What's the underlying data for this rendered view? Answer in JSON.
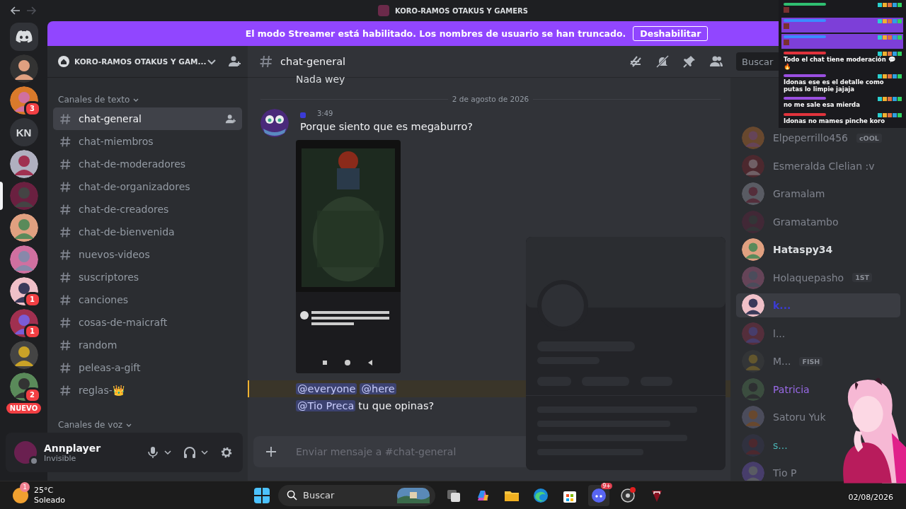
{
  "window": {
    "title": "KORO-RAMOS OTAKUS Y GAMERS"
  },
  "streamer_banner": {
    "text": "El modo Streamer está habilitado. Los nombres de usuario se han truncado.",
    "button": "Deshabilitar"
  },
  "servers": [
    {
      "kind": "logo",
      "selected": false
    },
    {
      "kind": "avatar",
      "selected": false
    },
    {
      "kind": "avatar",
      "selected": false,
      "badge": "3"
    },
    {
      "kind": "initials",
      "selected": false,
      "label": "KN"
    },
    {
      "kind": "avatar",
      "selected": false
    },
    {
      "kind": "avatar",
      "selected": true
    },
    {
      "kind": "avatar",
      "selected": false
    },
    {
      "kind": "avatar",
      "selected": false
    },
    {
      "kind": "avatar",
      "selected": false,
      "badge": "1"
    },
    {
      "kind": "avatar",
      "selected": false,
      "badge": "1"
    },
    {
      "kind": "avatar",
      "selected": false
    },
    {
      "kind": "avatar",
      "selected": false,
      "badge": "2"
    },
    {
      "kind": "new",
      "selected": false,
      "label": "NUEVO"
    }
  ],
  "server_header": {
    "name": "KORO-RAMOS OTAKUS Y GAM..."
  },
  "text_category": "Canales de texto",
  "channels": [
    {
      "name": "chat-general",
      "selected": true
    },
    {
      "name": "chat-miembros",
      "selected": false
    },
    {
      "name": "chat-de-moderadores",
      "selected": false
    },
    {
      "name": "chat-de-organizadores",
      "selected": false
    },
    {
      "name": "chat-de-creadores",
      "selected": false
    },
    {
      "name": "chat-de-bienvenida",
      "selected": false
    },
    {
      "name": "nuevos-videos",
      "selected": false
    },
    {
      "name": "suscriptores",
      "selected": false
    },
    {
      "name": "canciones",
      "selected": false
    },
    {
      "name": "cosas-de-maicraft",
      "selected": false
    },
    {
      "name": "random",
      "selected": false
    },
    {
      "name": "peleas-a-gift",
      "selected": false
    },
    {
      "name": "reglas-👑",
      "selected": false
    }
  ],
  "voice_category": "Canales de voz",
  "user_panel": {
    "name": "Annplayer",
    "status": "Invisible"
  },
  "chat_header": {
    "channel": "chat-general",
    "search_placeholder": "Buscar"
  },
  "messages": [
    {
      "kind": "continuation",
      "text": "Nada wey"
    },
    {
      "kind": "divider",
      "text": "2 de agosto de 2026"
    },
    {
      "kind": "post",
      "time": "3:49",
      "text": "Porque siento que es megaburro?"
    },
    {
      "kind": "attachment"
    },
    {
      "kind": "mentions",
      "highlighted": true,
      "mentions": [
        "@everyone",
        "@here"
      ]
    },
    {
      "kind": "mentions",
      "highlighted": false,
      "mentions": [
        "@Tio Preca"
      ],
      "text": "tu que opinas?"
    }
  ],
  "composer": {
    "placeholder": "Enviar mensaje a #chat-general"
  },
  "members": [
    {
      "name": "Elpeperrillo456",
      "dimmed": true,
      "selected": false,
      "color": "#80848e",
      "tag": "cOOL"
    },
    {
      "name": "Esmeralda Clelian :v",
      "dimmed": true,
      "selected": false,
      "color": "#80848e"
    },
    {
      "name": "Gramalam",
      "dimmed": true,
      "selected": false,
      "color": "#80848e"
    },
    {
      "name": "Gramatambo",
      "dimmed": true,
      "selected": false,
      "color": "#80848e"
    },
    {
      "name": "Hataspy34",
      "dimmed": false,
      "selected": false,
      "color": "#dbdee1"
    },
    {
      "name": "Holaquepasho",
      "dimmed": true,
      "selected": false,
      "color": "#80848e",
      "tag": "1ST"
    },
    {
      "name": "k...",
      "dimmed": false,
      "selected": true,
      "color": "#3b3bd6"
    },
    {
      "name": "l...",
      "dimmed": true,
      "selected": false
    },
    {
      "name": "M...",
      "dimmed": true,
      "selected": false,
      "color": "#80848e",
      "tag": "FISH"
    },
    {
      "name": "Patricia",
      "dimmed": true,
      "selected": false,
      "color": "#9a6ae8"
    },
    {
      "name": "Satoru Yuk",
      "dimmed": true,
      "selected": false,
      "color": "#80848e"
    },
    {
      "name": "s...",
      "dimmed": true,
      "selected": false,
      "color": "#4ab8b8"
    },
    {
      "name": "Tio P",
      "dimmed": true,
      "selected": false,
      "color": "#80848e"
    }
  ],
  "chat_overlay": [
    {
      "highlighted": false,
      "color": "#2fbf71"
    },
    {
      "highlighted": true,
      "color": "#3b8cff"
    },
    {
      "highlighted": true,
      "color": "#3b8cff"
    },
    {
      "highlighted": false,
      "color": "#e0333c",
      "text": "Todo el chat tiene moderación 💬🔥"
    },
    {
      "highlighted": false,
      "color": "#9a4fe0",
      "text": "Idonas ese es el detalle como putas lo limpie jajaja"
    },
    {
      "highlighted": false,
      "color": "#9a4fe0",
      "text": "no me sale esa mierda"
    },
    {
      "highlighted": false,
      "color": "#e0333c",
      "text": "Idonas no mames pinche koro"
    }
  ],
  "taskbar": {
    "temperature": "25°C",
    "weather": "Soleado",
    "weather_badge": "1",
    "search_placeholder": "Buscar",
    "discord_badge": "9+",
    "date": "02/08/2026"
  }
}
